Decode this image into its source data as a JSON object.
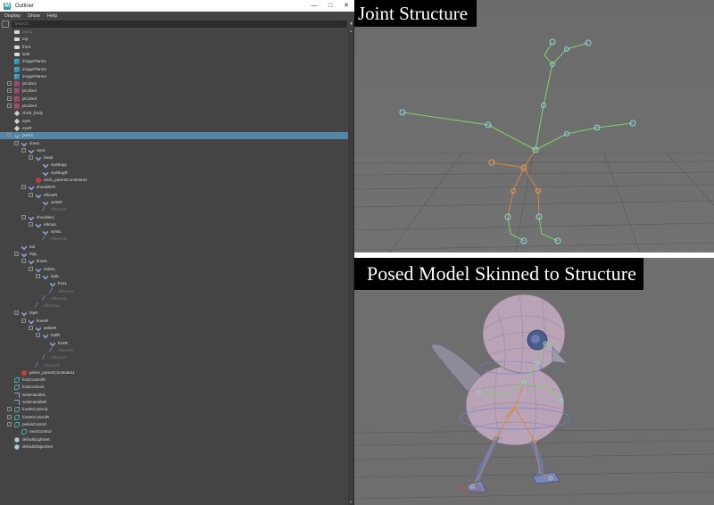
{
  "window": {
    "title": "Outliner",
    "controls": [
      "—",
      "□",
      "✕"
    ]
  },
  "menubar": [
    "Display",
    "Show",
    "Help"
  ],
  "search": {
    "placeholder": "Search..."
  },
  "outliner": {
    "items": [
      {
        "label": "persp",
        "depth": 0,
        "icon": "camera-icon",
        "dim": true
      },
      {
        "label": "top",
        "depth": 0,
        "icon": "camera-icon"
      },
      {
        "label": "front",
        "depth": 0,
        "icon": "camera-icon"
      },
      {
        "label": "side",
        "depth": 0,
        "icon": "camera-icon"
      },
      {
        "label": "imagePlane1",
        "depth": 0,
        "icon": "image-plane-icon"
      },
      {
        "label": "imagePlane2",
        "depth": 0,
        "icon": "image-plane-icon"
      },
      {
        "label": "imagePlane3",
        "depth": 0,
        "icon": "image-plane-icon"
      },
      {
        "label": "pCube1",
        "depth": 0,
        "icon": "mesh-icon",
        "expander": true
      },
      {
        "label": "pCube2",
        "depth": 0,
        "icon": "mesh-icon",
        "expander": true
      },
      {
        "label": "pCube3",
        "depth": 0,
        "icon": "mesh-icon",
        "expander": true
      },
      {
        "label": "pCube4",
        "depth": 0,
        "icon": "mesh-icon",
        "expander": true
      },
      {
        "label": "chick_body",
        "depth": 0,
        "icon": "transform-icon"
      },
      {
        "label": "eyeL",
        "depth": 0,
        "icon": "transform-icon"
      },
      {
        "label": "eyeR",
        "depth": 0,
        "icon": "transform-icon"
      },
      {
        "label": "pelvis",
        "depth": 0,
        "icon": "joint-icon",
        "expander": true,
        "selected": true
      },
      {
        "label": "chest",
        "depth": 1,
        "icon": "joint-icon",
        "expander": true
      },
      {
        "label": "neck",
        "depth": 2,
        "icon": "joint-icon",
        "expander": true
      },
      {
        "label": "head",
        "depth": 3,
        "icon": "joint-icon",
        "expander": true
      },
      {
        "label": "eyeBugL",
        "depth": 4,
        "icon": "joint-icon"
      },
      {
        "label": "eyeBugR",
        "depth": 4,
        "icon": "joint-icon"
      },
      {
        "label": "neck_parentConstraint1",
        "depth": 3,
        "icon": "constraint-icon"
      },
      {
        "label": "shoulderR",
        "depth": 2,
        "icon": "joint-icon",
        "expander": true
      },
      {
        "label": "elbowR",
        "depth": 3,
        "icon": "joint-icon",
        "expander": true
      },
      {
        "label": "wristR",
        "depth": 4,
        "icon": "joint-icon"
      },
      {
        "label": "effector4",
        "depth": 4,
        "icon": "effector-icon",
        "dim": true
      },
      {
        "label": "shoulderL",
        "depth": 2,
        "icon": "joint-icon",
        "expander": true
      },
      {
        "label": "elbowL",
        "depth": 3,
        "icon": "joint-icon",
        "expander": true
      },
      {
        "label": "wristL",
        "depth": 4,
        "icon": "joint-icon"
      },
      {
        "label": "effector3",
        "depth": 4,
        "icon": "effector-icon",
        "dim": true
      },
      {
        "label": "tail",
        "depth": 1,
        "icon": "joint-icon"
      },
      {
        "label": "hipL",
        "depth": 1,
        "icon": "joint-icon",
        "expander": true
      },
      {
        "label": "kneeL",
        "depth": 2,
        "icon": "joint-icon",
        "expander": true
      },
      {
        "label": "ankleL",
        "depth": 3,
        "icon": "joint-icon",
        "expander": true
      },
      {
        "label": "ballL",
        "depth": 4,
        "icon": "joint-icon",
        "expander": true
      },
      {
        "label": "footL",
        "depth": 5,
        "icon": "joint-icon"
      },
      {
        "label": "effector6",
        "depth": 5,
        "icon": "effector-icon",
        "dim": true
      },
      {
        "label": "effector5",
        "depth": 4,
        "icon": "effector-icon",
        "dim": true
      },
      {
        "label": "effector1",
        "depth": 3,
        "icon": "effector-icon",
        "dim": true
      },
      {
        "label": "hipR",
        "depth": 1,
        "icon": "joint-icon",
        "expander": true
      },
      {
        "label": "kneeR",
        "depth": 2,
        "icon": "joint-icon",
        "expander": true
      },
      {
        "label": "ankleR",
        "depth": 3,
        "icon": "joint-icon",
        "expander": true
      },
      {
        "label": "ballR",
        "depth": 4,
        "icon": "joint-icon",
        "expander": true
      },
      {
        "label": "footR",
        "depth": 5,
        "icon": "joint-icon"
      },
      {
        "label": "effector8",
        "depth": 5,
        "icon": "effector-icon",
        "dim": true
      },
      {
        "label": "effector7",
        "depth": 4,
        "icon": "effector-icon",
        "dim": true
      },
      {
        "label": "effector2",
        "depth": 3,
        "icon": "effector-icon",
        "dim": true
      },
      {
        "label": "pelvis_parentConstraint1",
        "depth": 1,
        "icon": "constraint-icon"
      },
      {
        "label": "footControlR",
        "depth": 0,
        "icon": "curve-icon"
      },
      {
        "label": "footControlL",
        "depth": 0,
        "icon": "curve-icon"
      },
      {
        "label": "wristHandleL",
        "depth": 0,
        "icon": "ik-handle-icon"
      },
      {
        "label": "wristHandleR",
        "depth": 0,
        "icon": "ik-handle-icon"
      },
      {
        "label": "footIKControlL",
        "depth": 0,
        "icon": "curve-icon",
        "expander": true
      },
      {
        "label": "footIKControlR",
        "depth": 0,
        "icon": "curve-icon",
        "expander": true
      },
      {
        "label": "pelvisControl",
        "depth": 0,
        "icon": "curve-icon",
        "expander": true
      },
      {
        "label": "neckControl",
        "depth": 1,
        "icon": "curve-icon"
      },
      {
        "label": "defaultLightSet",
        "depth": 0,
        "icon": "set-icon"
      },
      {
        "label": "defaultObjectSet",
        "depth": 0,
        "icon": "set-icon"
      }
    ]
  },
  "viewports": {
    "top_caption": "Joint Structure",
    "bottom_caption": "Posed Model Skinned to Structure"
  },
  "colors": {
    "viewport_bg": "#6e6e6e",
    "outliner_bg": "#444444",
    "selection": "#5285a6",
    "joint_green": "#7fd26a",
    "joint_orange": "#d9863a",
    "model_pink": "#b9a3b6"
  }
}
